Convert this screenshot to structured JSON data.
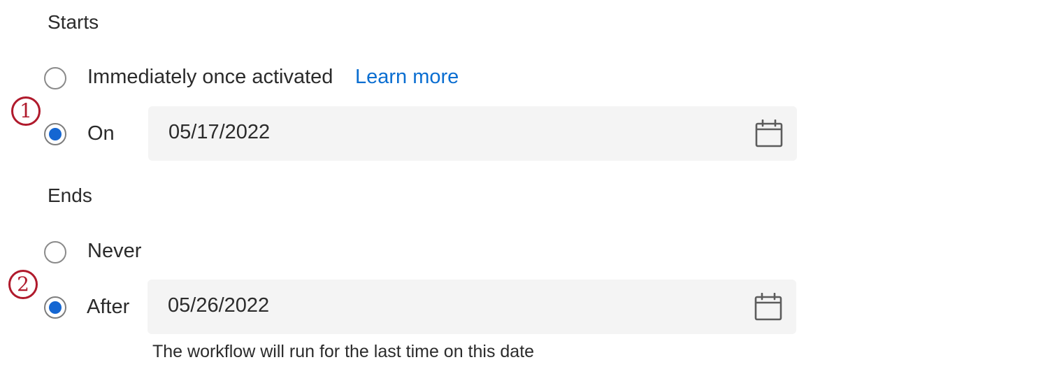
{
  "starts": {
    "heading": "Starts",
    "options": [
      {
        "label": "Immediately once activated",
        "selected": false,
        "link": "Learn more"
      },
      {
        "label": "On",
        "selected": true,
        "date": "05/17/2022"
      }
    ]
  },
  "ends": {
    "heading": "Ends",
    "options": [
      {
        "label": "Never",
        "selected": false
      },
      {
        "label": "After",
        "selected": true,
        "date": "05/26/2022",
        "helper": "The workflow will run for the last time on this date"
      }
    ]
  },
  "annotations": [
    "1",
    "2"
  ],
  "colors": {
    "accent": "#1466d2",
    "link": "#0a6ed1",
    "annotation": "#b01a2c",
    "field_bg": "#f4f4f4"
  },
  "icons": {
    "date_picker": "calendar-icon"
  }
}
